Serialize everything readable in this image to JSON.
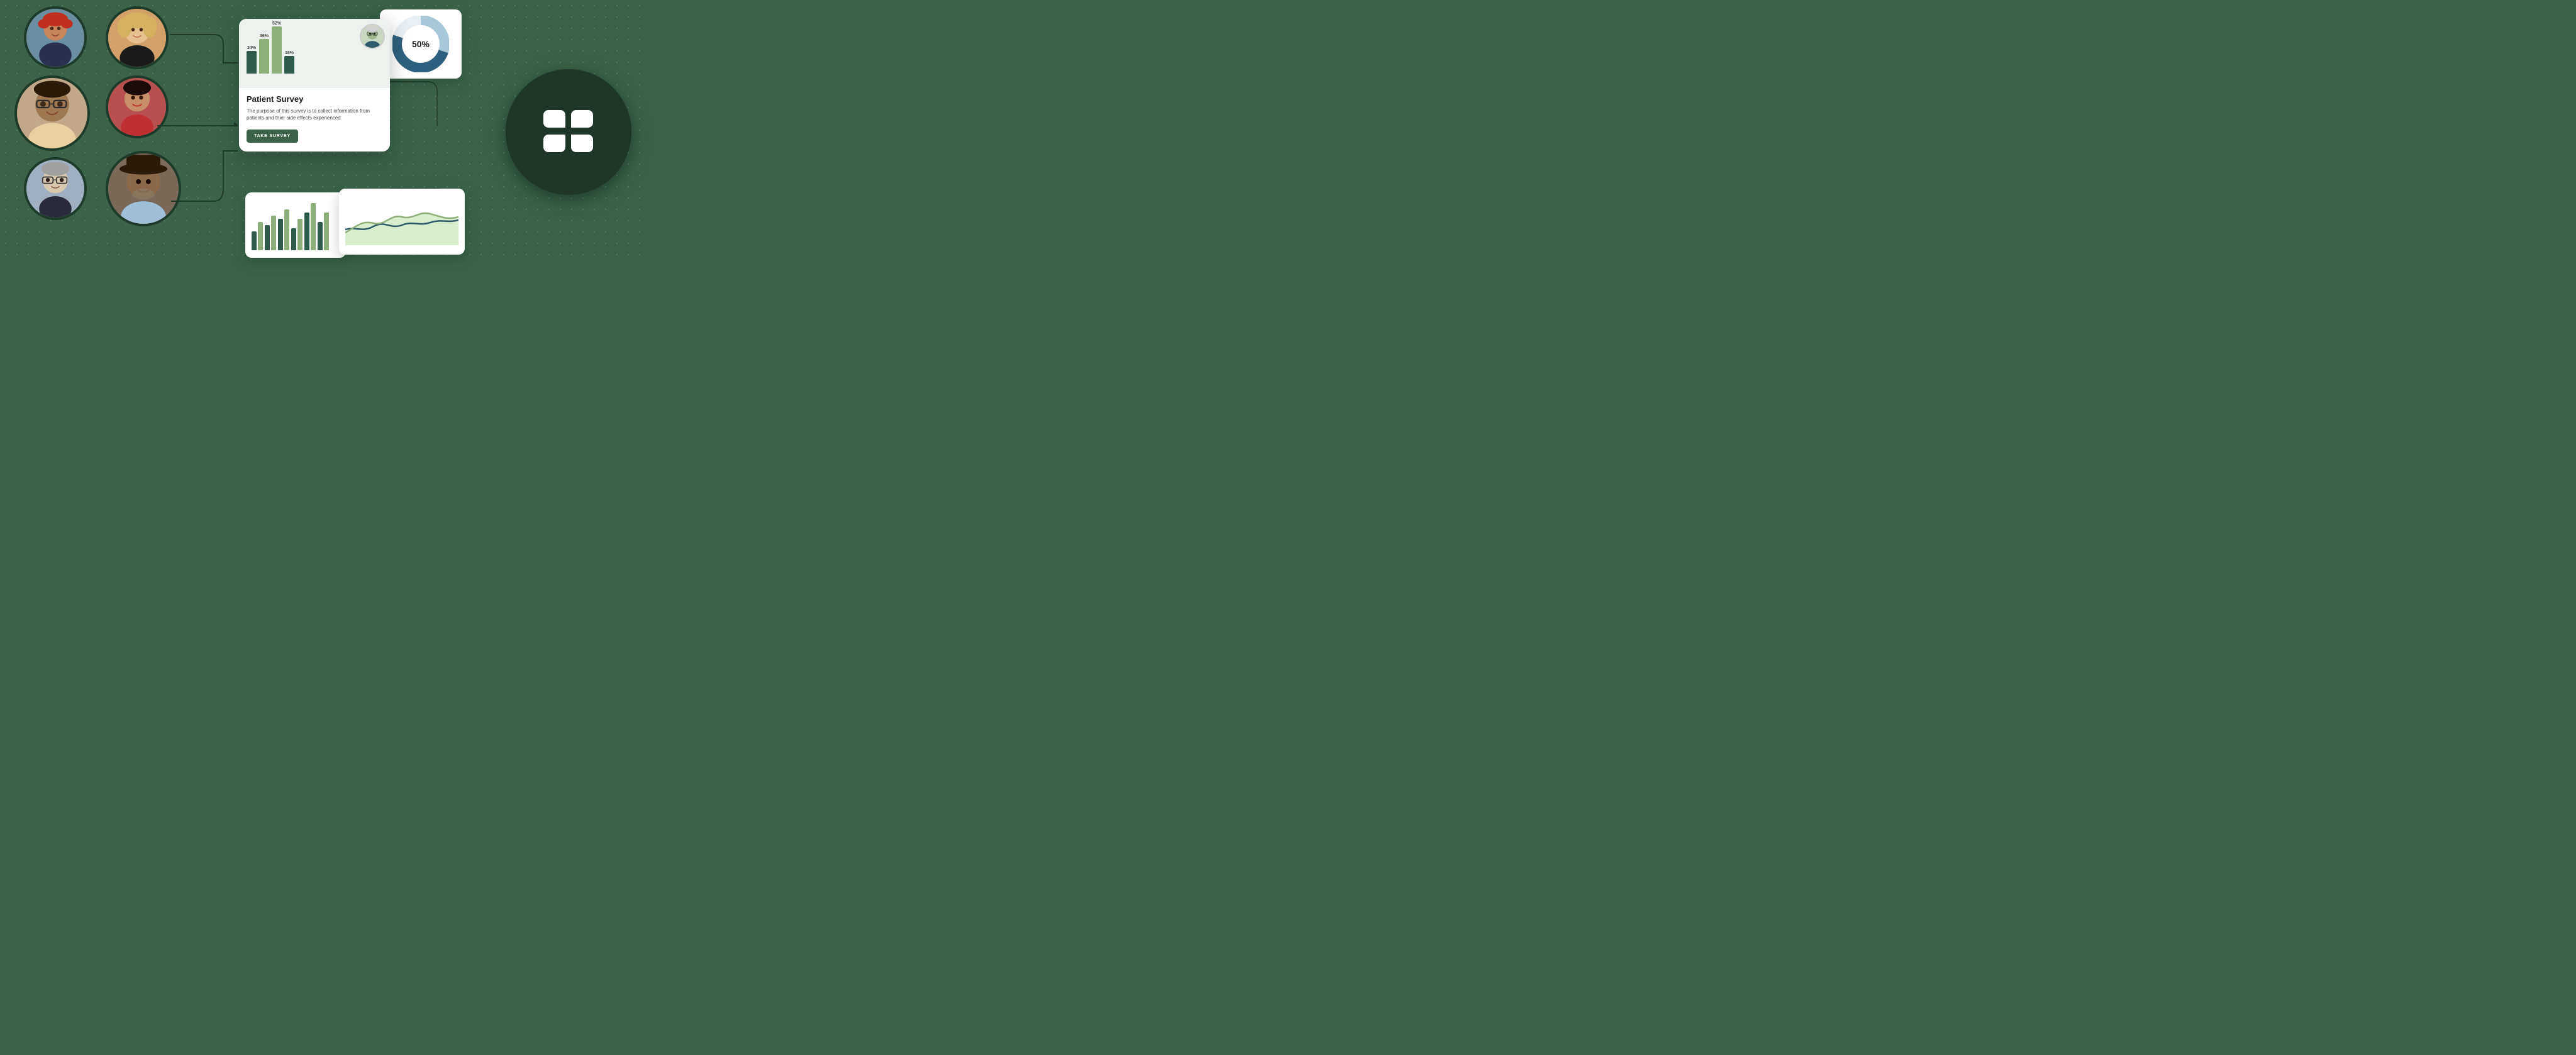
{
  "scene": {
    "background_color": "#3a6349"
  },
  "survey_card": {
    "title": "Patient Survey",
    "description": "The purpose of this survey is to collect information from patients and thier side effects experienced",
    "button_label": "TAKE SURVEY",
    "chart": {
      "bars": [
        {
          "label": "24%",
          "value": 24,
          "color": "dark"
        },
        {
          "label": "36%",
          "value": 36,
          "color": "light"
        },
        {
          "label": "52%",
          "value": 52,
          "color": "light"
        },
        {
          "label": "18%",
          "value": 18,
          "color": "dark"
        }
      ]
    }
  },
  "donut_chart": {
    "label": "50%",
    "segments": [
      {
        "value": 50,
        "color": "#2d6080"
      },
      {
        "value": 30,
        "color": "#a8c8d8"
      },
      {
        "value": 20,
        "color": "#e8f0f5"
      }
    ]
  },
  "people": [
    {
      "id": 1,
      "alt": "Woman with red hair"
    },
    {
      "id": 2,
      "alt": "Woman with blonde hair"
    },
    {
      "id": 3,
      "alt": "Man with glasses"
    },
    {
      "id": 4,
      "alt": "Woman in red"
    },
    {
      "id": 5,
      "alt": "Man with glasses white"
    },
    {
      "id": 6,
      "alt": "Man with hat"
    }
  ],
  "logo": {
    "aria_label": "App logo grid"
  }
}
